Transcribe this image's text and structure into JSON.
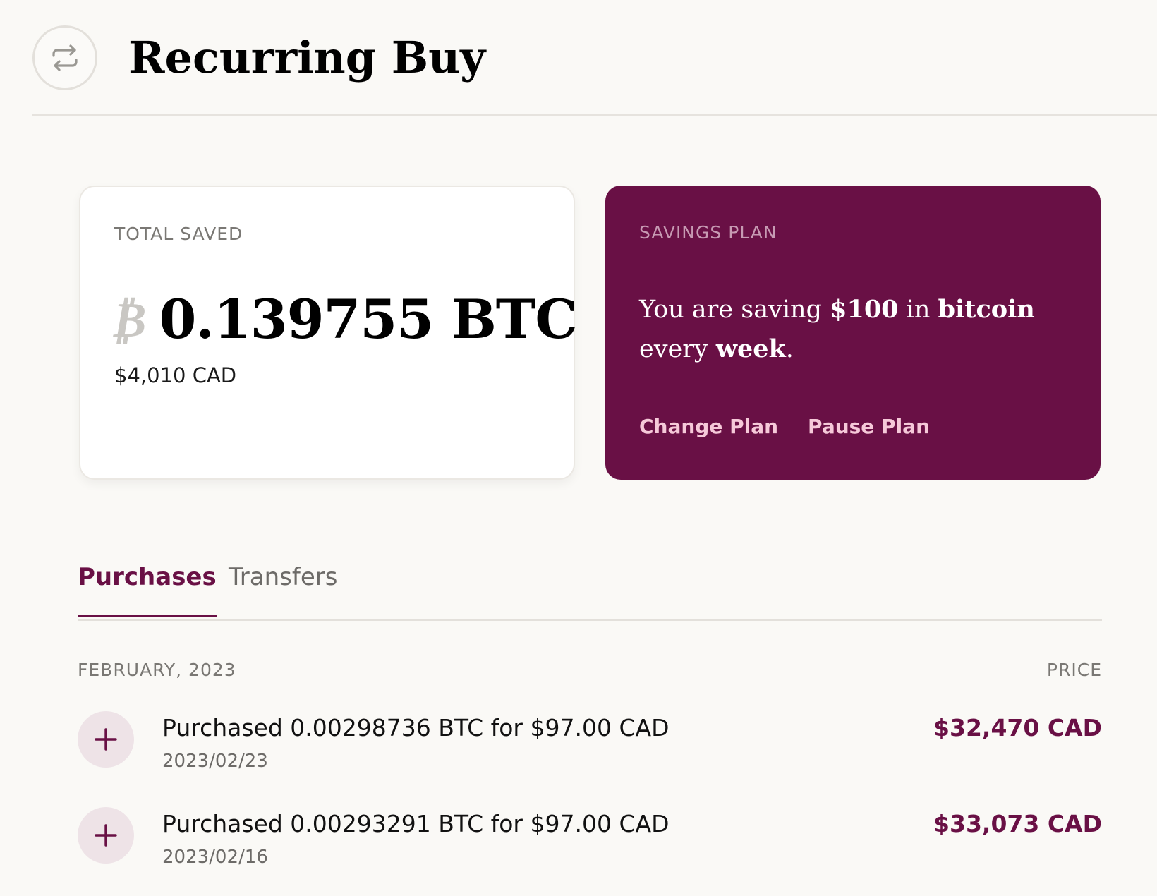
{
  "header": {
    "title": "Recurring Buy",
    "icon": "repeat-icon"
  },
  "total_saved": {
    "label": "TOTAL SAVED",
    "btc_symbol": "₿",
    "btc_amount": "0.139755 BTC",
    "cad_value": "$4,010 CAD"
  },
  "savings_plan": {
    "label": "SAVINGS PLAN",
    "text_prefix": "You are saving ",
    "amount": "$100",
    "text_mid1": " in ",
    "asset": "bitcoin",
    "text_mid2": " every ",
    "frequency": "week",
    "text_suffix": ".",
    "change_label": "Change Plan",
    "pause_label": "Pause Plan"
  },
  "tabs": [
    {
      "label": "Purchases",
      "active": true
    },
    {
      "label": "Transfers",
      "active": false
    }
  ],
  "list": {
    "month": "FEBRUARY, 2023",
    "price_header": "PRICE",
    "rows": [
      {
        "title": "Purchased 0.00298736 BTC for $97.00 CAD",
        "date": "2023/02/23",
        "price": "$32,470 CAD",
        "icon": "plus-icon"
      },
      {
        "title": "Purchased 0.00293291 BTC for $97.00 CAD",
        "date": "2023/02/16",
        "price": "$33,073 CAD",
        "icon": "plus-icon"
      }
    ]
  },
  "colors": {
    "accent": "#691045",
    "background": "#faf9f6",
    "link_on_accent": "#f6c9d9"
  }
}
